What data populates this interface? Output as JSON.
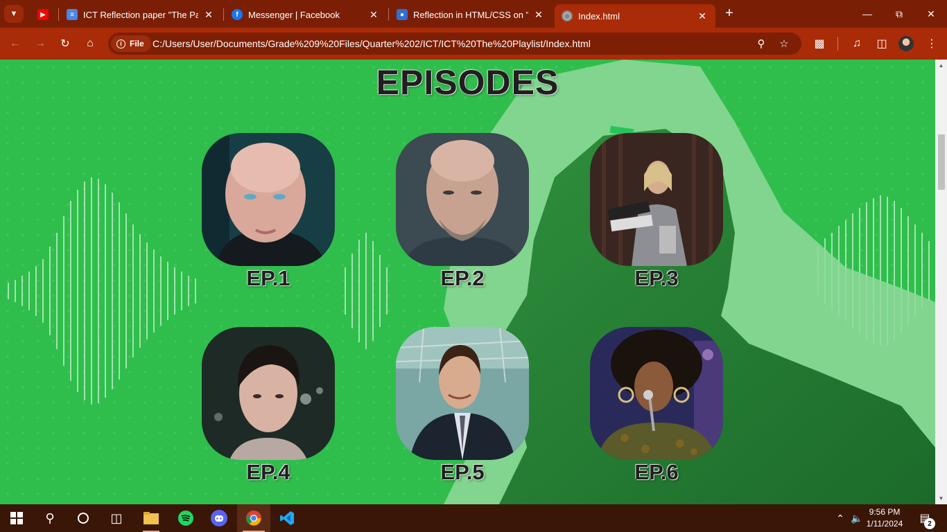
{
  "browser": {
    "tabs": [
      {
        "title": "",
        "icon": "youtube-icon",
        "color": "#ff0000"
      },
      {
        "title": "ICT Reflection paper \"The Palylis",
        "icon": "docs-icon",
        "color": "#4a86e8"
      },
      {
        "title": "Messenger | Facebook",
        "icon": "facebook-icon",
        "color": "#1877f2"
      },
      {
        "title": "Reflection in HTML/CSS on \"The",
        "icon": "classroom-icon",
        "color": "#2f6fd6"
      },
      {
        "title": "Index.html",
        "icon": "globe-icon",
        "color": "#cfcfcf",
        "active": true
      }
    ],
    "scheme_chip": "File",
    "url": "C:/Users/User/Documents/Grade%209%20Files/Quarter%202/ICT/ICT%20The%20Playlist/Index.html",
    "theme_color": "#a92b08"
  },
  "page": {
    "heading": "EPISODES",
    "background_color": "#2fbe4c",
    "episodes": [
      {
        "label": "EP.1"
      },
      {
        "label": "EP.2"
      },
      {
        "label": "EP.3"
      },
      {
        "label": "EP.4"
      },
      {
        "label": "EP.5"
      },
      {
        "label": "EP.6"
      }
    ]
  },
  "taskbar": {
    "apps": [
      "start-icon",
      "search-icon",
      "cortana-icon",
      "task-view-icon",
      "file-explorer-icon",
      "spotify-icon",
      "discord-icon",
      "chrome-icon",
      "vscode-icon"
    ],
    "time": "9:56 PM",
    "date": "1/11/2024",
    "notifications": "2"
  }
}
